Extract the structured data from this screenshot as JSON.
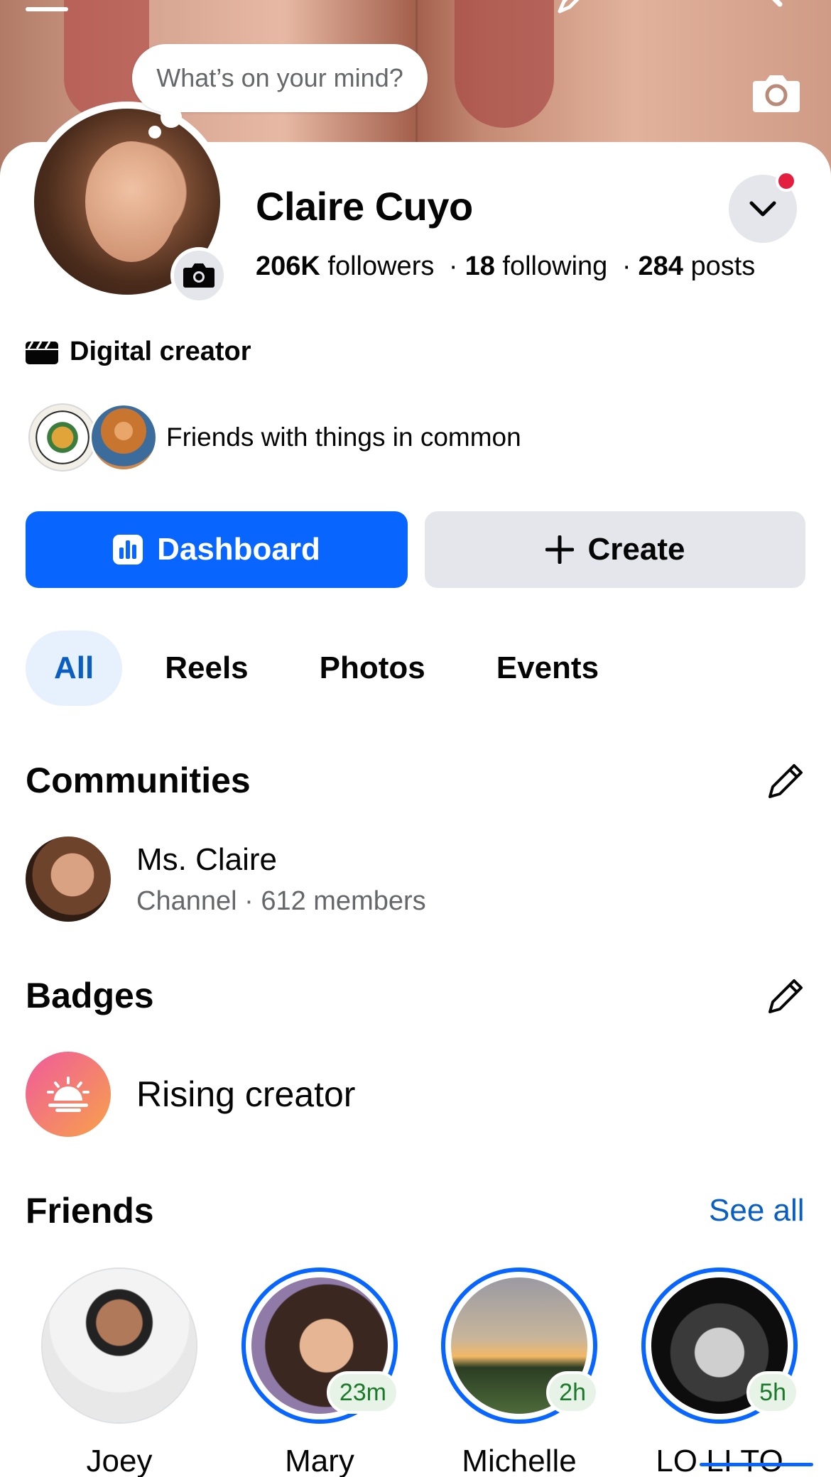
{
  "composer": {
    "placeholder": "What’s on your mind?"
  },
  "profile": {
    "name": "Claire Cuyo",
    "followers_count": "206K",
    "followers_label": "followers",
    "following_count": "18",
    "following_label": "following",
    "posts_count": "284",
    "posts_label": "posts",
    "separator": "·",
    "category": "Digital creator",
    "mutual_text": "Friends with things in common"
  },
  "actions": {
    "dashboard_label": "Dashboard",
    "create_label": "Create"
  },
  "tabs": [
    {
      "label": "All",
      "active": true
    },
    {
      "label": "Reels",
      "active": false
    },
    {
      "label": "Photos",
      "active": false
    },
    {
      "label": "Events",
      "active": false
    }
  ],
  "communities": {
    "title": "Communities",
    "items": [
      {
        "name": "Ms. Claire",
        "meta": "Channel · 612 members"
      }
    ]
  },
  "badges": {
    "title": "Badges",
    "items": [
      {
        "label": "Rising creator"
      }
    ]
  },
  "friends": {
    "title": "Friends",
    "see_all": "See all",
    "items": [
      {
        "name": "Joey",
        "time": "",
        "has_story": false
      },
      {
        "name": "Mary",
        "time": "23m",
        "has_story": true
      },
      {
        "name": "Michelle",
        "time": "2h",
        "has_story": true
      },
      {
        "name": "LO LI TO",
        "time": "5h",
        "has_story": true
      }
    ]
  },
  "colors": {
    "accent": "#0866ff",
    "notification": "#e41e3f",
    "secondary_button": "#e4e6eb",
    "active_tab_bg": "#e7f0fd"
  },
  "icons": [
    "menu-icon",
    "pencil-icon",
    "search-icon",
    "camera-icon",
    "chevron-down-icon",
    "clapperboard-icon",
    "bar-chart-icon",
    "plus-icon",
    "sunrise-icon"
  ]
}
